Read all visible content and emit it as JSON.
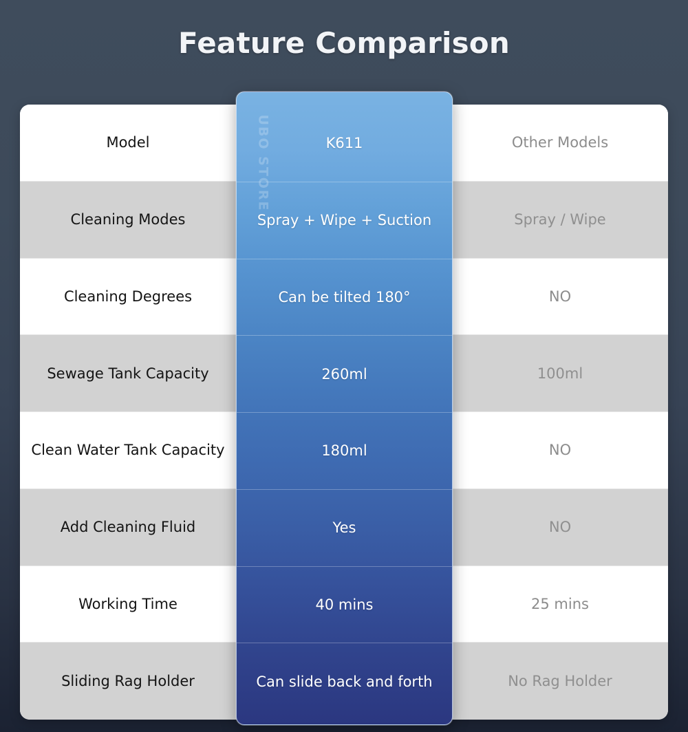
{
  "page": {
    "title": "Feature Comparison",
    "watermark": "UBO STORE",
    "background_top_color": "#3f4c5c",
    "background_bottom_color": "#1b2232"
  },
  "table": {
    "columns": [
      {
        "key": "feature",
        "label": ""
      },
      {
        "key": "k611",
        "label": "K611",
        "highlight": true,
        "accent_top": "#79b2e2",
        "accent_bottom": "#2b3780"
      },
      {
        "key": "other",
        "label": "Other Models",
        "highlight": false,
        "text_color": "#8c8c8c"
      }
    ],
    "rows": [
      {
        "feature": "Model",
        "k611": "K611",
        "other": "Other Models",
        "shaded": false
      },
      {
        "feature": "Cleaning Modes",
        "k611": "Spray + Wipe + Suction",
        "other": "Spray / Wipe",
        "shaded": true
      },
      {
        "feature": "Cleaning Degrees",
        "k611": "Can be tilted 180°",
        "other": "NO",
        "shaded": false
      },
      {
        "feature": "Sewage Tank Capacity",
        "k611": "260ml",
        "other": "100ml",
        "shaded": true
      },
      {
        "feature": "Clean Water Tank Capacity",
        "k611": "180ml",
        "other": "NO",
        "shaded": false
      },
      {
        "feature": "Add Cleaning Fluid",
        "k611": "Yes",
        "other": "NO",
        "shaded": true
      },
      {
        "feature": "Working Time",
        "k611": "40 mins",
        "other": "25 mins",
        "shaded": false
      },
      {
        "feature": "Sliding Rag Holder",
        "k611": "Can slide back and forth",
        "other": "No Rag Holder",
        "shaded": true
      }
    ]
  }
}
